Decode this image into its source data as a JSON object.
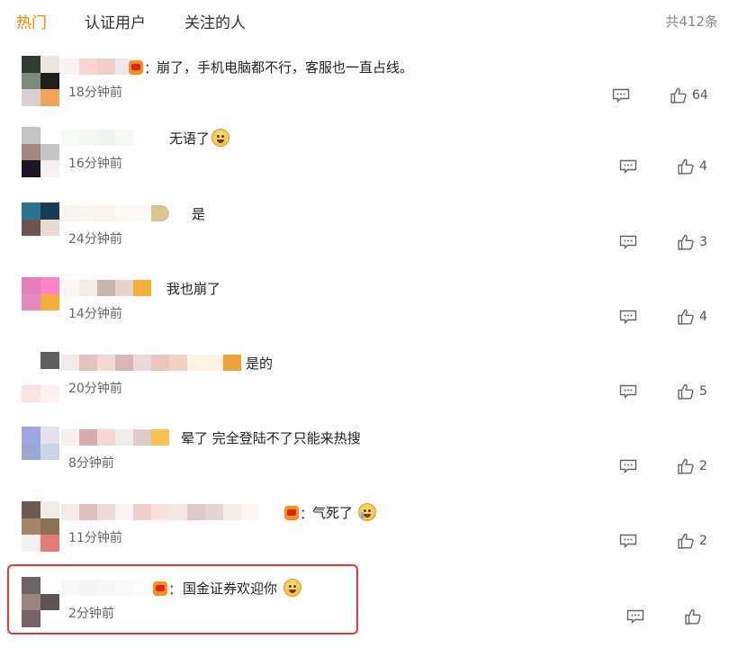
{
  "tabs": [
    {
      "label": "热门",
      "active": true
    },
    {
      "label": "认证用户",
      "active": false
    },
    {
      "label": "关注的人",
      "active": false
    }
  ],
  "total_count": "共412条",
  "colors": {
    "accent": "#ff8200",
    "highlight": "#e53935"
  },
  "comments": [
    {
      "text": "崩了，手机电脑都不行，客服也一直占线。",
      "time": "18分钟前",
      "likes": "64",
      "has_badge": true
    },
    {
      "text": "无语了",
      "time": "16分钟前",
      "likes": "4",
      "has_badge": false,
      "emoji": "sweat-emoji"
    },
    {
      "text": "是",
      "time": "24分钟前",
      "likes": "3",
      "has_badge": false
    },
    {
      "text": "我也崩了",
      "time": "14分钟前",
      "likes": "4",
      "has_badge": false
    },
    {
      "text": "是的",
      "time": "20分钟前",
      "likes": "5",
      "has_badge": false
    },
    {
      "text": "晕了 完全登陆不了只能来热搜",
      "time": "8分钟前",
      "likes": "2",
      "has_badge": false
    },
    {
      "text": "气死了",
      "time": "11分钟前",
      "likes": "2",
      "has_badge": true,
      "emoji": "crying-emoji"
    },
    {
      "text": "国金证券欢迎你",
      "time": "2分钟前",
      "likes": "",
      "has_badge": true,
      "emoji": "laughing-emoji",
      "highlighted": true
    }
  ],
  "colon": "："
}
